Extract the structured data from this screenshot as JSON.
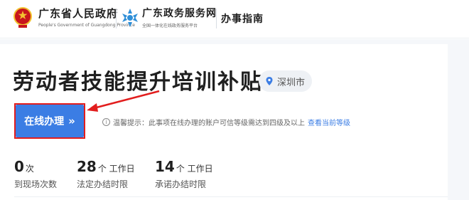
{
  "header": {
    "gov_title": "广东省人民政府",
    "gov_subtitle": "People's Government of Guangdong Province",
    "portal_title": "广东政务服务网",
    "portal_subtitle": "全国一体化在线政务服务平台",
    "guide_label": "办事指南"
  },
  "service": {
    "title": "劳动者技能提升培训补贴",
    "region": "深圳市"
  },
  "actions": {
    "apply_label": "在线办理",
    "apply_chevron": "»",
    "notice_icon": "i",
    "notice_text": "温馨提示：此事项在线办理的账户可信等级需达到四级及以上",
    "notice_link": "查看当前等级"
  },
  "stats": [
    {
      "num": "0",
      "unit": "次",
      "label": "到现场次数"
    },
    {
      "num": "28",
      "unit": "个 工作日",
      "label": "法定办结时限"
    },
    {
      "num": "14",
      "unit": "个 工作日",
      "label": "承诺办结时限"
    }
  ],
  "colors": {
    "accent": "#3b7de4",
    "highlight": "#e21d1d",
    "emblem": "#c8161d",
    "emblem_gold": "#f2c230",
    "portal_logo": "#2f8fd8"
  }
}
